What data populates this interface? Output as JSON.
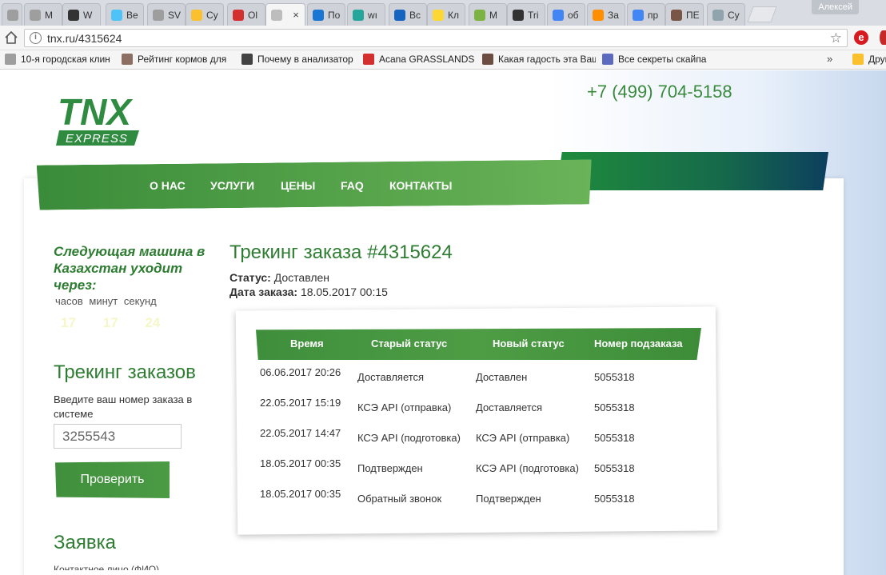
{
  "browser": {
    "tabs": [
      {
        "label": "M",
        "color": "#9e9e9e"
      },
      {
        "label": "M",
        "color": "#9e9e9e"
      },
      {
        "label": "W",
        "color": "#333333"
      },
      {
        "label": "Be",
        "color": "#4fc3f7"
      },
      {
        "label": "SV",
        "color": "#9e9e9e"
      },
      {
        "label": "Cy",
        "color": "#fbc02d"
      },
      {
        "label": "Ol",
        "color": "#d32f2f"
      },
      {
        "label": "",
        "color": "#bdbdbd"
      },
      {
        "label": "По",
        "color": "#1976d2"
      },
      {
        "label": "wı",
        "color": "#26a69a"
      },
      {
        "label": "Вс",
        "color": "#1565c0"
      },
      {
        "label": "Кл",
        "color": "#fdd835"
      },
      {
        "label": "M",
        "color": "#7cb342"
      },
      {
        "label": "Tri",
        "color": "#333333"
      },
      {
        "label": "об",
        "color": "#4285f4"
      },
      {
        "label": "За",
        "color": "#ff8f00"
      },
      {
        "label": "пр",
        "color": "#4285f4"
      },
      {
        "label": "ПЕ",
        "color": "#795548"
      },
      {
        "label": "Cy",
        "color": "#90a4ae"
      }
    ],
    "close_glyph": "×",
    "user": "Алексей",
    "url": "tnx.ru/4315624",
    "info_glyph": "i",
    "star_glyph": "☆",
    "ext_glyph": "e",
    "bookmarks": [
      {
        "label": "10-я городская клин",
        "color": "#9e9e9e"
      },
      {
        "label": "Рейтинг кормов для",
        "color": "#8d6e63"
      },
      {
        "label": "Почему в анализатор",
        "color": "#424242"
      },
      {
        "label": "Acana GRASSLANDS",
        "color": "#d32f2f"
      },
      {
        "label": "Какая гадость эта Ваш",
        "color": "#6d4c41"
      },
      {
        "label": "Все секреты скайпа",
        "color": "#5c6bc0"
      },
      {
        "label": "Друг",
        "color": "#fbc02d"
      }
    ],
    "bookmarks_more": "»"
  },
  "site": {
    "logo_top": "TNX",
    "logo_bottom": "EXPRESS",
    "phone": "+7 (499) 704-5158",
    "nav": [
      "О НАС",
      "УСЛУГИ",
      "ЦЕНЫ",
      "FAQ",
      "КОНТАКТЫ"
    ]
  },
  "sidebar": {
    "next_car": "Следующая машина в Казахстан уходит через:",
    "timer_labels": [
      "часов",
      "минут",
      "секунд"
    ],
    "timer_values": [
      "17",
      "17",
      "24"
    ],
    "tracking_title": "Трекинг заказов",
    "tracking_prompt": "Введите ваш номер заказа в системе",
    "tracking_value": "3255543",
    "check_button": "Проверить",
    "request_title": "Заявка",
    "cut_text": "Контактное лицо (ФИО)"
  },
  "order": {
    "title": "Трекинг заказа #4315624",
    "status_label": "Статус:",
    "status_value": "Доставлен",
    "date_label": "Дата заказа:",
    "date_value": "18.05.2017 00:15",
    "columns": [
      "Время",
      "Старый статус",
      "Новый статус",
      "Номер подзаказа"
    ],
    "rows": [
      [
        "06.06.2017 20:26",
        "Доставляется",
        "Доставлен",
        "5055318"
      ],
      [
        "22.05.2017 15:19",
        "КСЭ API (отправка)",
        "Доставляется",
        "5055318"
      ],
      [
        "22.05.2017 14:47",
        "КСЭ API (подготовка)",
        "КСЭ API (отправка)",
        "5055318"
      ],
      [
        "18.05.2017 00:35",
        "Подтвержден",
        "КСЭ API (подготовка)",
        "5055318"
      ],
      [
        "18.05.2017 00:35",
        "Обратный звонок",
        "Подтвержден",
        "5055318"
      ]
    ]
  },
  "colors": {
    "brand_green": "#2e7d32",
    "nav_green": "#52a048",
    "nav_dark": "#0c3f5e"
  }
}
